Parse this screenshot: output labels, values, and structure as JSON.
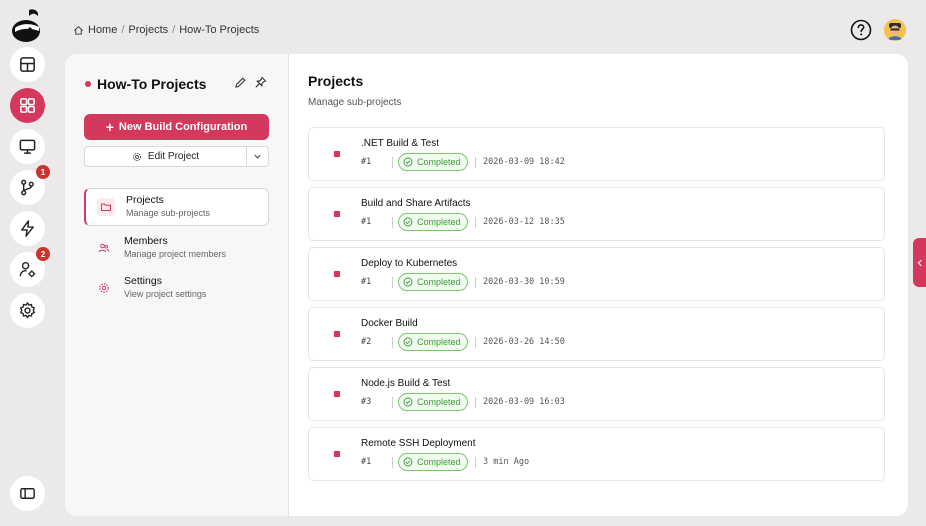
{
  "breadcrumb": {
    "items": [
      "Home",
      "Projects",
      "How-To Projects"
    ],
    "separator": "/"
  },
  "rail": {
    "items": [
      {
        "icon": "dashboard-icon"
      },
      {
        "icon": "projects-grid-icon",
        "active": true
      },
      {
        "icon": "monitor-icon"
      },
      {
        "icon": "git-branch-icon",
        "badge": "1"
      },
      {
        "icon": "lightning-icon"
      },
      {
        "icon": "user-settings-icon",
        "badge": "2"
      },
      {
        "icon": "gear-icon"
      },
      {
        "icon": "sidebar-toggle-icon"
      }
    ]
  },
  "sidebar": {
    "title": "How-To Projects",
    "new_build_label": "New Build Configuration",
    "edit_label": "Edit Project",
    "nav": [
      {
        "label": "Projects",
        "sub": "Manage sub-projects",
        "icon": "folder-icon",
        "active": true
      },
      {
        "label": "Members",
        "sub": "Manage project members",
        "icon": "users-icon"
      },
      {
        "label": "Settings",
        "sub": "View project settings",
        "icon": "gear-icon"
      }
    ]
  },
  "main": {
    "title": "Projects",
    "subtitle": "Manage sub-projects",
    "builds": [
      {
        "name": ".NET Build & Test",
        "number": "#1",
        "status": "Completed",
        "time": "2026-03-09 18:42"
      },
      {
        "name": "Build and Share Artifacts",
        "number": "#1",
        "status": "Completed",
        "time": "2026-03-12 18:35"
      },
      {
        "name": "Deploy to Kubernetes",
        "number": "#1",
        "status": "Completed",
        "time": "2026-03-30 10:59"
      },
      {
        "name": "Docker Build",
        "number": "#2",
        "status": "Completed",
        "time": "2026-03-26 14:50"
      },
      {
        "name": "Node.js Build & Test",
        "number": "#3",
        "status": "Completed",
        "time": "2026-03-09 16:03"
      },
      {
        "name": "Remote SSH Deployment",
        "number": "#1",
        "status": "Completed",
        "time": "3 min Ago"
      }
    ]
  },
  "colors": {
    "accent": "#d4385c",
    "success": "#3e9c3a",
    "badge": "#c8352f"
  }
}
